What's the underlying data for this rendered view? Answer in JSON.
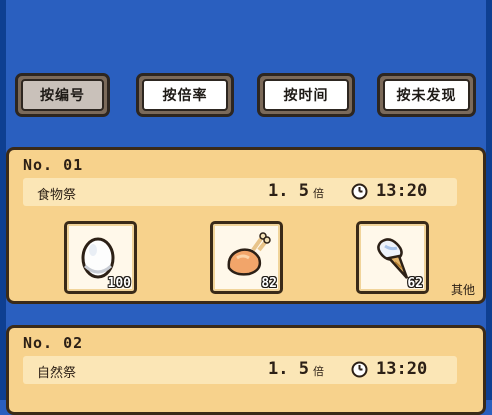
{
  "sort_buttons": [
    {
      "label": "按编号"
    },
    {
      "label": "按倍率"
    },
    {
      "label": "按时间"
    },
    {
      "label": "按未发现"
    }
  ],
  "entries": [
    {
      "no": "No. 01",
      "event": "食物祭",
      "multiplier": "1. 5",
      "multiplier_unit": "倍",
      "time": "13:20",
      "items": [
        {
          "icon": "egg-icon",
          "count": "100"
        },
        {
          "icon": "roast-chicken-icon",
          "count": "82"
        },
        {
          "icon": "ice-cream-icon",
          "count": "62"
        }
      ],
      "other_label": "其他"
    },
    {
      "no": "No. 02",
      "event": "自然祭",
      "multiplier": "1. 5",
      "multiplier_unit": "倍",
      "time": "13:20"
    }
  ],
  "colors": {
    "background": "#2a5fbf",
    "panel": "#f7d28c",
    "info_bar": "#fbe6b6",
    "outline": "#3a2a18"
  }
}
